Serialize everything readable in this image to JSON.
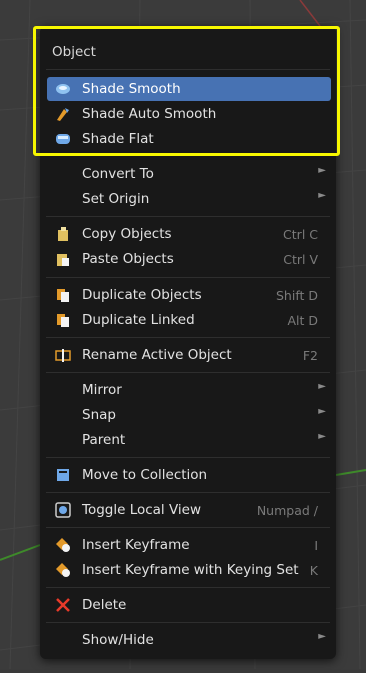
{
  "menu": {
    "title": "Object",
    "items": [
      {
        "label": "Shade Smooth",
        "icon": "shade-smooth-icon"
      },
      {
        "label": "Shade Auto Smooth",
        "icon": "auto-smooth-icon"
      },
      {
        "label": "Shade Flat",
        "icon": "shade-flat-icon"
      },
      {
        "label": "Convert To",
        "submenu": "►"
      },
      {
        "label": "Set Origin",
        "submenu": "►"
      },
      {
        "label": "Copy Objects",
        "shortcut": "Ctrl C",
        "icon": "copy-icon"
      },
      {
        "label": "Paste Objects",
        "shortcut": "Ctrl V",
        "icon": "paste-icon"
      },
      {
        "label": "Duplicate Objects",
        "shortcut": "Shift D",
        "icon": "duplicate-icon"
      },
      {
        "label": "Duplicate Linked",
        "shortcut": "Alt D",
        "icon": "duplicate-linked-icon"
      },
      {
        "label": "Rename Active Object",
        "shortcut": "F2",
        "icon": "rename-icon"
      },
      {
        "label": "Mirror",
        "submenu": "►"
      },
      {
        "label": "Snap",
        "submenu": "►"
      },
      {
        "label": "Parent",
        "submenu": "►"
      },
      {
        "label": "Move to Collection",
        "icon": "collection-icon"
      },
      {
        "label": "Toggle Local View",
        "shortcut": "Numpad /",
        "icon": "local-view-icon"
      },
      {
        "label": "Insert Keyframe",
        "shortcut": "I",
        "icon": "keyframe-icon"
      },
      {
        "label": "Insert Keyframe with Keying Set",
        "shortcut": "K",
        "icon": "keying-set-icon"
      },
      {
        "label": "Delete",
        "icon": "delete-icon"
      },
      {
        "label": "Show/Hide",
        "submenu": "►"
      }
    ]
  },
  "colors": {
    "highlight_border": "#f7f700",
    "active_item": "#4772b3",
    "menu_bg": "#181818"
  }
}
